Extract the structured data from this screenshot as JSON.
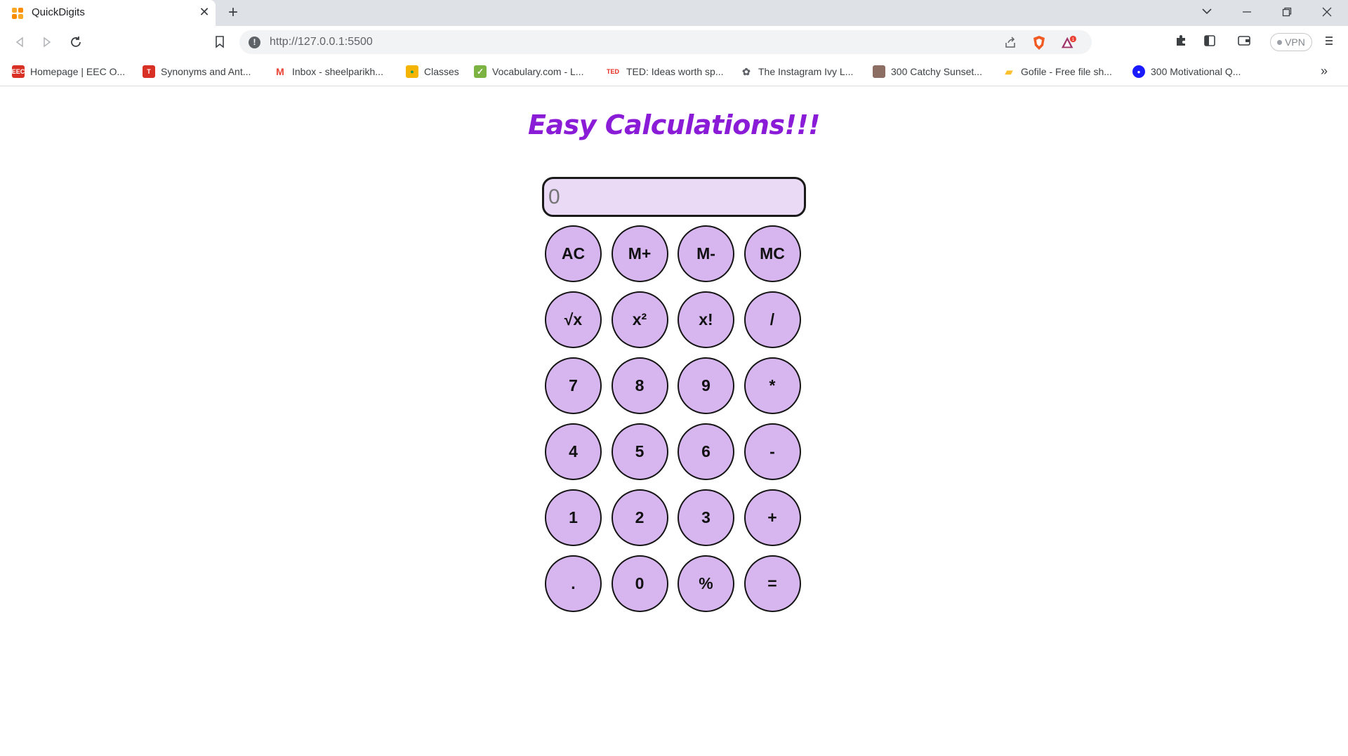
{
  "browser": {
    "tab_title": "QuickDigits",
    "url": "http://127.0.0.1:5500",
    "vpn_label": "VPN",
    "bookmarks": [
      {
        "label": "Homepage | EEC O...",
        "icon": "eec-icon",
        "color": "#d93025"
      },
      {
        "label": "Synonyms and Ant...",
        "icon": "thesaurus-icon",
        "color": "#d93025"
      },
      {
        "label": "Inbox - sheelparikh...",
        "icon": "gmail-icon",
        "color": "#ea4335"
      },
      {
        "label": "Classes",
        "icon": "classroom-icon",
        "color": "#f4b400"
      },
      {
        "label": "Vocabulary.com - L...",
        "icon": "vocabulary-icon",
        "color": "#7cb342"
      },
      {
        "label": "TED: Ideas worth sp...",
        "icon": "ted-icon",
        "color": "#e62b1e"
      },
      {
        "label": "The Instagram Ivy L...",
        "icon": "ivy-icon",
        "color": "#5f6368"
      },
      {
        "label": "300 Catchy Sunset...",
        "icon": "sunset-icon",
        "color": "#8d6e63"
      },
      {
        "label": "Gofile - Free file sh...",
        "icon": "gofile-icon",
        "color": "#fbc02d"
      },
      {
        "label": "300 Motivational Q...",
        "icon": "motivational-icon",
        "color": "#1a1aff"
      }
    ]
  },
  "app": {
    "title": "Easy Calculations!!!",
    "display_placeholder": "0",
    "accent_color": "#8a1bd6",
    "key_color": "#d7b6ef",
    "display_color": "#eadaf6",
    "keys": [
      "AC",
      "M+",
      "M-",
      "MC",
      "√x",
      "x²",
      "x!",
      "/",
      "7",
      "8",
      "9",
      "*",
      "4",
      "5",
      "6",
      "-",
      "1",
      "2",
      "3",
      "+",
      ".",
      "0",
      "%",
      "="
    ]
  }
}
